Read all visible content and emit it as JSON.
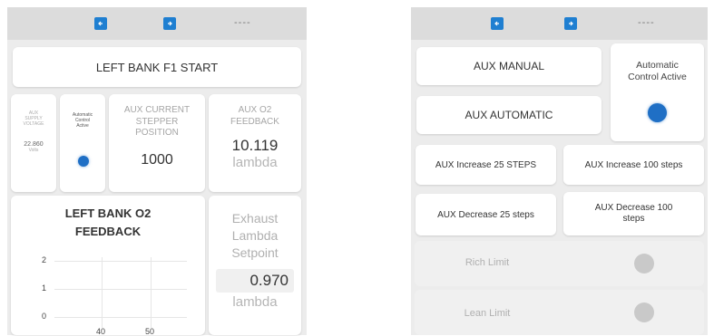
{
  "left": {
    "nav": {
      "dots": "----"
    },
    "start_button": "LEFT BANK F1 START",
    "aux_supply": {
      "label_line1": "AUX",
      "label_line2": "SUPPLY",
      "label_line3": "VOLTAGE",
      "value": "22.860",
      "unit": "Volts"
    },
    "auto_control": {
      "label_line1": "Automatic",
      "label_line2": "Control",
      "label_line3": "Active"
    },
    "stepper": {
      "label_line1": "AUX CURRENT",
      "label_line2": "STEPPER",
      "label_line3": "POSITION",
      "value": "1000"
    },
    "o2_feedback": {
      "label_line1": "AUX O2",
      "label_line2": "FEEDBACK",
      "value": "10.119",
      "unit": "lambda"
    },
    "chart": {
      "title_line1": "LEFT BANK O2",
      "title_line2": "FEEDBACK"
    },
    "setpoint": {
      "label_line1": "Exhaust",
      "label_line2": "Lambda",
      "label_line3": "Setpoint",
      "value": "0.970",
      "unit": "lambda"
    }
  },
  "right": {
    "nav": {
      "dots": "----"
    },
    "aux_manual": "AUX MANUAL",
    "aux_automatic": "AUX AUTOMATIC",
    "auto_control": {
      "label_line1": "Automatic",
      "label_line2": "Control Active"
    },
    "inc25": "AUX Increase 25 STEPS",
    "inc100": "AUX Increase 100 steps",
    "dec25": "AUX Decrease 25 steps",
    "dec100_line1": "AUX Decrease 100",
    "dec100_line2": "steps",
    "rich_limit": "Rich Limit",
    "lean_limit": "Lean Limit"
  },
  "colors": {
    "accent": "#1f7fd1",
    "indicator_on": "#1f6fc5",
    "indicator_off": "#c9c9c9"
  },
  "chart_data": {
    "type": "line",
    "title": "LEFT BANK O2 FEEDBACK",
    "yticks": [
      "2",
      "1",
      "0"
    ],
    "xticks": [
      "40",
      "50"
    ],
    "ylim": [
      0,
      2
    ],
    "series": []
  }
}
